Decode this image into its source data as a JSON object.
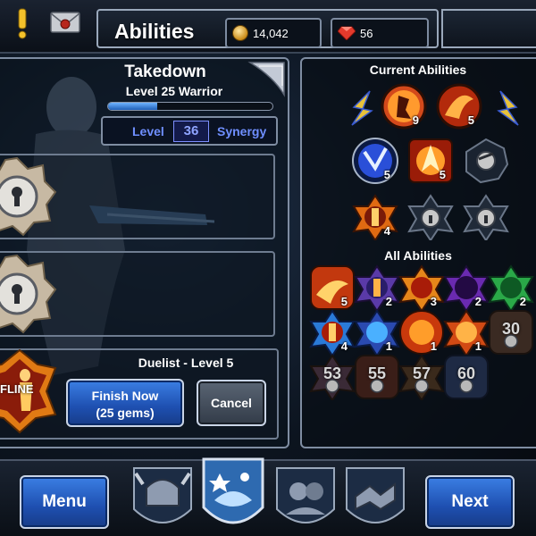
{
  "screen_title": "Abilities",
  "currency": {
    "gold": "14,042",
    "gems": "56"
  },
  "hero": {
    "name": "Takedown",
    "level_text": "Level 25 Warrior",
    "xp_progress": 0.3,
    "synergy_label_left": "Level",
    "synergy_value": "36",
    "synergy_label_right": "Synergy"
  },
  "training": {
    "title": "Duelist - Level 5",
    "badge_text": "FLINE",
    "finish_label_line1": "Finish Now",
    "finish_label_line2": "(25 gems)",
    "cancel_label": "Cancel"
  },
  "current_abilities": {
    "title": "Current Abilities",
    "levels": [
      "9",
      "5",
      "5",
      "5",
      "",
      "4",
      "",
      ""
    ]
  },
  "all_abilities": {
    "title": "All Abilities",
    "row1": [
      "5",
      "2",
      "3",
      "2",
      "2"
    ],
    "row2": [
      "4",
      "1",
      "1",
      "1"
    ],
    "locked_levels": [
      "30",
      "53",
      "55",
      "57",
      "60"
    ]
  },
  "nav": {
    "menu_label": "Menu",
    "next_label": "Next"
  },
  "colors": {
    "accent_blue": "#1e4fb0",
    "gold": "#e0a020",
    "gem_red": "#e43a2c",
    "synergy_text": "#6f8fff"
  }
}
